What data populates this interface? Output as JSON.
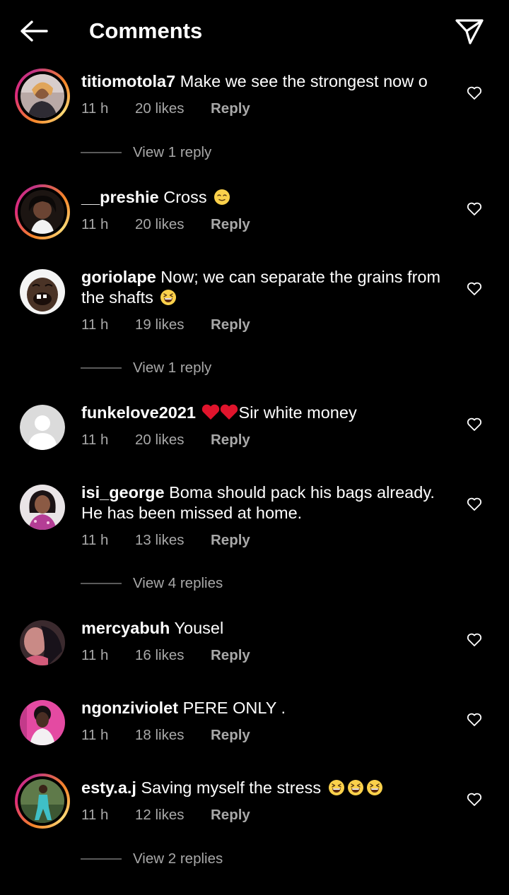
{
  "header": {
    "title": "Comments",
    "back_icon": "arrow-left-icon",
    "send_icon": "paper-plane-icon"
  },
  "comments": [
    {
      "username": "titiomotola7",
      "text": "Make we see the strongest now o",
      "time": "11 h",
      "likes": "20 likes",
      "reply": "Reply",
      "view_replies": "View 1 reply",
      "avatar_ring": true
    },
    {
      "username": "__preshie",
      "text": "Cross",
      "emoji": "relieved-face",
      "time": "11 h",
      "likes": "20 likes",
      "reply": "Reply",
      "avatar_ring": true
    },
    {
      "username": "goriolape",
      "text": "Now; we can separate the grains from the shafts",
      "emoji": "grinning-squinting-face",
      "time": "11 h",
      "likes": "19 likes",
      "reply": "Reply",
      "view_replies": "View 1 reply"
    },
    {
      "username": "funkelove2021",
      "text_prefix_emoji": "red-heart x2",
      "text": "Sir white money",
      "time": "11 h",
      "likes": "20 likes",
      "reply": "Reply"
    },
    {
      "username": "isi_george",
      "text": "Boma should pack his bags already. He has been missed at home.",
      "time": "11 h",
      "likes": "13 likes",
      "reply": "Reply",
      "view_replies": "View 4 replies"
    },
    {
      "username": "mercyabuh",
      "text": "Yousel",
      "time": "11 h",
      "likes": "16 likes",
      "reply": "Reply"
    },
    {
      "username": "ngonziviolet",
      "text": "PERE ONLY .",
      "time": "11 h",
      "likes": "18 likes",
      "reply": "Reply"
    },
    {
      "username": "esty.a.j",
      "text": "Saving myself the stress",
      "emoji": "grinning-squinting-face x3",
      "time": "11 h",
      "likes": "12 likes",
      "reply": "Reply",
      "view_replies": "View 2 replies",
      "avatar_ring": true
    }
  ],
  "colors": {
    "background": "#000000",
    "primary_text": "#ffffff",
    "secondary_text": "#a8a8a8",
    "story_ring": "#dd2a7b"
  }
}
